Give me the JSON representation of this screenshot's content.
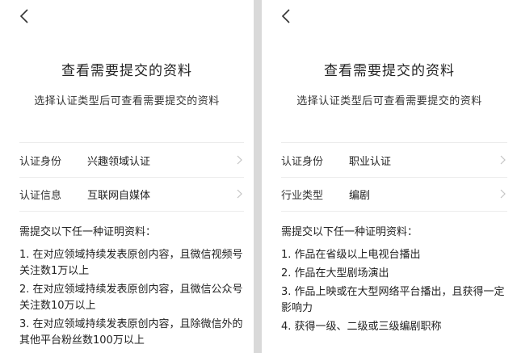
{
  "left": {
    "title": "查看需要提交的资料",
    "subtitle": "选择认证类型后可查看需要提交的资料",
    "rows": [
      {
        "label": "认证身份",
        "value": "兴趣领域认证"
      },
      {
        "label": "认证信息",
        "value": "互联网自媒体"
      }
    ],
    "requirements_heading": "需提交以下任一种证明资料：",
    "requirements": [
      "1. 在对应领域持续发表原创内容，且微信视频号关注数1万以上",
      "2. 在对应领域持续发表原创内容，且微信公众号关注数10万以上",
      "3. 在对应领域持续发表原创内容，且除微信外的其他平台粉丝数100万以上"
    ]
  },
  "right": {
    "title": "查看需要提交的资料",
    "subtitle": "选择认证类型后可查看需要提交的资料",
    "rows": [
      {
        "label": "认证身份",
        "value": "职业认证"
      },
      {
        "label": "行业类型",
        "value": "编剧"
      }
    ],
    "requirements_heading": "需提交以下任一种证明资料：",
    "requirements": [
      "1. 作品在省级以上电视台播出",
      "2. 作品在大型剧场演出",
      "3. 作品上映或在大型网络平台播出，且获得一定影响力",
      "4. 获得一级、二级或三级编剧职称"
    ]
  },
  "icons": {
    "back": "chevron-left-icon",
    "row_arrow": "chevron-right-icon"
  },
  "colors": {
    "divider": "#ececec",
    "chevron": "#c4c4c4"
  }
}
